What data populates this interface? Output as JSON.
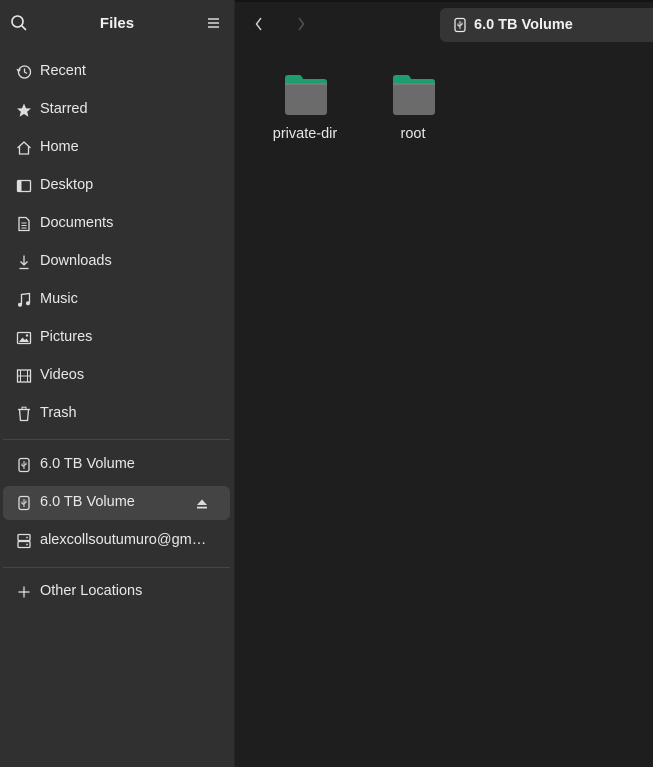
{
  "sidebar": {
    "title": "Files",
    "places": [
      {
        "label": "Recent",
        "icon": "clock-icon"
      },
      {
        "label": "Starred",
        "icon": "star-icon"
      },
      {
        "label": "Home",
        "icon": "home-icon"
      },
      {
        "label": "Desktop",
        "icon": "desktop-icon"
      },
      {
        "label": "Documents",
        "icon": "document-icon"
      },
      {
        "label": "Downloads",
        "icon": "download-icon"
      },
      {
        "label": "Music",
        "icon": "music-icon"
      },
      {
        "label": "Pictures",
        "icon": "picture-icon"
      },
      {
        "label": "Videos",
        "icon": "video-icon"
      },
      {
        "label": "Trash",
        "icon": "trash-icon"
      }
    ],
    "devices": [
      {
        "label": "6.0 TB Volume",
        "icon": "usb-drive-icon",
        "selected": false,
        "eject": false
      },
      {
        "label": "6.0 TB Volume",
        "icon": "usb-drive-icon",
        "selected": true,
        "eject": true
      },
      {
        "label": "alexcollsoutumuro@gm…",
        "icon": "network-drive-icon",
        "selected": false,
        "eject": false
      }
    ],
    "other": {
      "label": "Other Locations",
      "icon": "plus-icon"
    }
  },
  "toolbar": {
    "path_label": "6.0 TB Volume"
  },
  "files": [
    {
      "name": "private-dir",
      "type": "folder"
    },
    {
      "name": "root",
      "type": "folder"
    }
  ],
  "colors": {
    "accent_folder_tab": "#1e9e6e",
    "folder_body": "#6b6b6b",
    "sidebar_bg": "#303030",
    "main_bg": "#1e1e1e",
    "selected_bg": "#444444"
  }
}
